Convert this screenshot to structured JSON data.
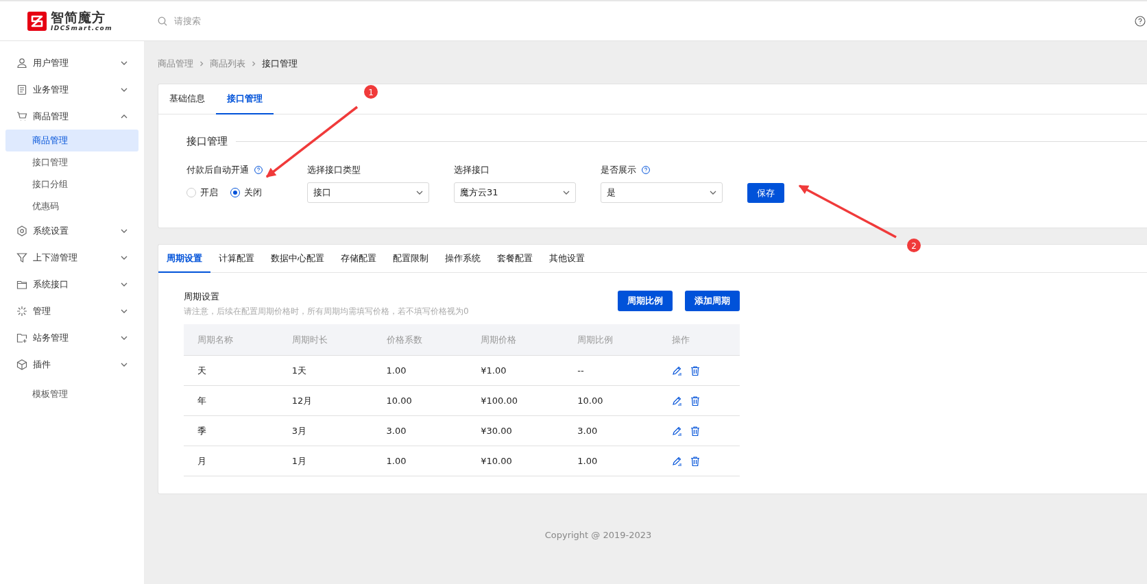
{
  "header": {
    "logo": {
      "name": "智简魔方",
      "domain": "IDCSmart.com"
    },
    "search": {
      "placeholder": "请搜索"
    }
  },
  "sidebar": {
    "items": [
      {
        "kind": "group",
        "label": "用户管理",
        "expanded": false
      },
      {
        "kind": "group",
        "label": "业务管理",
        "expanded": false
      },
      {
        "kind": "group",
        "label": "商品管理",
        "expanded": true,
        "children": [
          {
            "label": "商品管理",
            "selected": true
          },
          {
            "label": "接口管理",
            "selected": false
          },
          {
            "label": "接口分组",
            "selected": false
          },
          {
            "label": "优惠码",
            "selected": false
          }
        ]
      },
      {
        "kind": "group",
        "label": "系统设置",
        "expanded": false
      },
      {
        "kind": "group",
        "label": "上下游管理",
        "expanded": false
      },
      {
        "kind": "group",
        "label": "系统接口",
        "expanded": false
      },
      {
        "kind": "group",
        "label": "管理",
        "expanded": false
      },
      {
        "kind": "group",
        "label": "站务管理",
        "expanded": false
      },
      {
        "kind": "group",
        "label": "插件",
        "expanded": false
      },
      {
        "kind": "link",
        "label": "模板管理"
      }
    ]
  },
  "breadcrumb": [
    "商品管理",
    "商品列表",
    "接口管理"
  ],
  "top_tabs": [
    {
      "label": "基础信息",
      "selected": false
    },
    {
      "label": "接口管理",
      "selected": true
    }
  ],
  "interface_section": {
    "title": "接口管理",
    "fields": [
      {
        "kind": "radio",
        "label": "付款后自动开通",
        "help": true,
        "options": [
          {
            "label": "开启",
            "selected": false
          },
          {
            "label": "关闭",
            "selected": true
          }
        ]
      },
      {
        "kind": "select",
        "label": "选择接口类型",
        "help": false,
        "value": "接口"
      },
      {
        "kind": "select",
        "label": "选择接口",
        "help": false,
        "value": "魔方云31"
      },
      {
        "kind": "select",
        "label": "是否展示",
        "help": true,
        "value": "是"
      }
    ],
    "save_button": "保存"
  },
  "config_tabs": [
    {
      "label": "周期设置",
      "selected": true
    },
    {
      "label": "计算配置",
      "selected": false
    },
    {
      "label": "数据中心配置",
      "selected": false
    },
    {
      "label": "存储配置",
      "selected": false
    },
    {
      "label": "配置限制",
      "selected": false
    },
    {
      "label": "操作系统",
      "selected": false
    },
    {
      "label": "套餐配置",
      "selected": false
    },
    {
      "label": "其他设置",
      "selected": false
    }
  ],
  "period_section": {
    "title": "周期设置",
    "note": "请注意，后续在配置周期价格时，所有周期均需填写价格，若不填写价格视为0",
    "buttons": [
      "周期比例",
      "添加周期"
    ],
    "table": {
      "columns": [
        "周期名称",
        "周期时长",
        "价格系数",
        "周期价格",
        "周期比例",
        "操作"
      ],
      "rows": [
        [
          "天",
          "1天",
          "1.00",
          "¥1.00",
          "--"
        ],
        [
          "年",
          "12月",
          "10.00",
          "¥100.00",
          "10.00"
        ],
        [
          "季",
          "3月",
          "3.00",
          "¥30.00",
          "3.00"
        ],
        [
          "月",
          "1月",
          "1.00",
          "¥10.00",
          "1.00"
        ]
      ]
    }
  },
  "footer": "Copyright @ 2019-2023",
  "annotations": [
    {
      "label": "1"
    },
    {
      "label": "2"
    }
  ]
}
